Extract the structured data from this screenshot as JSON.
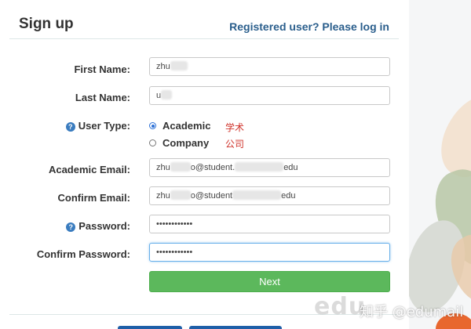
{
  "header": {
    "title": "Sign up",
    "login_link": "Registered user? Please log in"
  },
  "form": {
    "first_name": {
      "label": "First Name:",
      "value": "zhu"
    },
    "last_name": {
      "label": "Last Name:",
      "value": "u"
    },
    "user_type": {
      "label": "User Type:",
      "options": [
        {
          "label": "Academic",
          "checked": true,
          "annotation": "学术"
        },
        {
          "label": "Company",
          "checked": false,
          "annotation": "公司"
        }
      ]
    },
    "academic_email": {
      "label": "Academic Email:",
      "value_start": "zhu",
      "value_mid": "o@student.",
      "value_end": "edu"
    },
    "confirm_email": {
      "label": "Confirm Email:",
      "value_start": "zhu",
      "value_mid": "o@student",
      "value_end": "edu"
    },
    "password": {
      "label": "Password:",
      "value": "••••••••••••"
    },
    "confirm_password": {
      "label": "Confirm Password:",
      "value": "••••••••••••"
    },
    "next_label": "Next"
  },
  "watermark": {
    "left": "edu",
    "right": "知乎 @edumail"
  },
  "colors": {
    "link": "#2a5e8c",
    "next_button": "#5cb85c",
    "annotation": "#d0342c",
    "help_icon": "#3a7cbf"
  },
  "icons": [
    "help-icon",
    "radio-checked",
    "radio-unchecked"
  ]
}
